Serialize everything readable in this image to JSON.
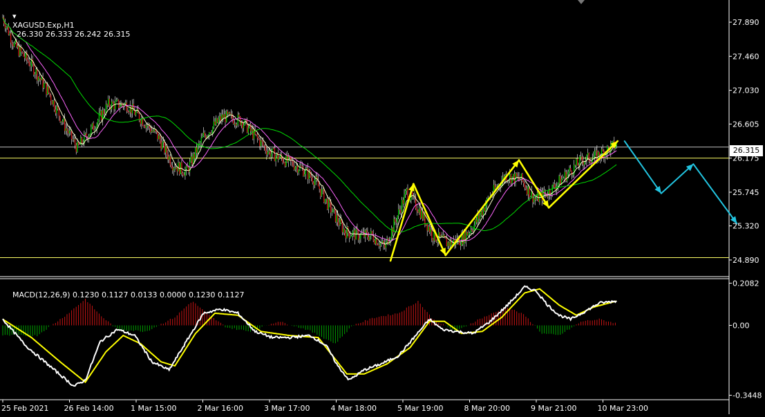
{
  "window": {
    "symbol": "XAGUSD.Exp,H1",
    "ohlc": "26.330 26.333 26.242 26.315"
  },
  "macd": {
    "label": "MACD(12,26,9) 0.1230 0.1127 0.0133 0.0000 0.1230 0.1127"
  },
  "current_price": "26.315",
  "colors": {
    "background": "#000000",
    "bull_candle": "#00c800",
    "bear_candle": "#c81414",
    "wick": "#ffffff",
    "ma_fast": "#ffffcc",
    "ma_mid": "#ff66ff",
    "ma_slow": "#00dd00",
    "horizontal_line": "#ffff66",
    "current_price_line": "#c0c0c0",
    "wave_arrow": "#ffff00",
    "projection_arrow": "#22c4e0",
    "macd_main": "#ffffff",
    "macd_signal": "#ffff00",
    "hist_positive": "#c81414",
    "hist_negative": "#00a000",
    "axis_text": "#ffffff"
  },
  "chart_data": [
    {
      "type": "candlestick",
      "title": "XAGUSD.Exp,H1",
      "y_ticks": [
        "27.890",
        "27.460",
        "27.030",
        "26.605",
        "26.175",
        "25.745",
        "25.320",
        "24.890"
      ],
      "ylim": [
        24.75,
        28.1
      ],
      "x_ticks": [
        "25 Feb 2021",
        "26 Feb 14:00",
        "1 Mar 15:00",
        "2 Mar 16:00",
        "3 Mar 17:00",
        "4 Mar 18:00",
        "5 Mar 19:00",
        "8 Mar 20:00",
        "9 Mar 21:00",
        "10 Mar 23:00"
      ],
      "close_path": [
        [
          0,
          27.95
        ],
        [
          10,
          27.6
        ],
        [
          25,
          27.35
        ],
        [
          40,
          27.0
        ],
        [
          55,
          26.55
        ],
        [
          65,
          26.3
        ],
        [
          78,
          26.55
        ],
        [
          92,
          26.85
        ],
        [
          108,
          26.85
        ],
        [
          122,
          26.65
        ],
        [
          135,
          26.45
        ],
        [
          148,
          26.1
        ],
        [
          160,
          26.0
        ],
        [
          175,
          26.45
        ],
        [
          192,
          26.7
        ],
        [
          208,
          26.65
        ],
        [
          220,
          26.45
        ],
        [
          232,
          26.25
        ],
        [
          246,
          26.15
        ],
        [
          260,
          26.05
        ],
        [
          272,
          25.9
        ],
        [
          285,
          25.55
        ],
        [
          298,
          25.25
        ],
        [
          310,
          25.2
        ],
        [
          322,
          25.2
        ],
        [
          333,
          25.05
        ],
        [
          340,
          25.3
        ],
        [
          352,
          25.75
        ],
        [
          362,
          25.55
        ],
        [
          375,
          25.2
        ],
        [
          388,
          25.1
        ],
        [
          400,
          25.15
        ],
        [
          412,
          25.35
        ],
        [
          425,
          25.7
        ],
        [
          438,
          25.95
        ],
        [
          452,
          25.9
        ],
        [
          464,
          25.65
        ],
        [
          476,
          25.75
        ],
        [
          490,
          25.95
        ],
        [
          505,
          26.15
        ],
        [
          518,
          26.2
        ],
        [
          535,
          26.35
        ]
      ],
      "horizontal_levels": [
        26.175,
        24.92
      ],
      "current_price": 26.315,
      "wave_path": [
        [
          338,
          24.88
        ],
        [
          358,
          25.85
        ],
        [
          386,
          24.95
        ],
        [
          450,
          26.15
        ],
        [
          476,
          25.55
        ],
        [
          536,
          26.39
        ]
      ],
      "projection_path": [
        [
          542,
          26.39
        ],
        [
          574,
          25.73
        ],
        [
          602,
          26.1
        ],
        [
          640,
          25.35
        ]
      ]
    },
    {
      "type": "line",
      "title": "MACD(12,26,9)",
      "y_ticks": [
        "0.2082",
        "0.00",
        "-0.3448"
      ],
      "ylim": [
        -0.36,
        0.22
      ],
      "series": [
        {
          "name": "MACD",
          "points": [
            [
              0,
              0.03
            ],
            [
              20,
              -0.1
            ],
            [
              45,
              -0.22
            ],
            [
              62,
              -0.3
            ],
            [
              72,
              -0.27
            ],
            [
              85,
              -0.08
            ],
            [
              100,
              -0.02
            ],
            [
              115,
              -0.05
            ],
            [
              130,
              -0.18
            ],
            [
              145,
              -0.22
            ],
            [
              160,
              -0.08
            ],
            [
              175,
              0.06
            ],
            [
              190,
              0.08
            ],
            [
              205,
              0.06
            ],
            [
              220,
              -0.03
            ],
            [
              235,
              -0.06
            ],
            [
              250,
              -0.06
            ],
            [
              268,
              -0.05
            ],
            [
              282,
              -0.1
            ],
            [
              292,
              -0.2
            ],
            [
              302,
              -0.27
            ],
            [
              315,
              -0.22
            ],
            [
              330,
              -0.19
            ],
            [
              345,
              -0.15
            ],
            [
              360,
              -0.05
            ],
            [
              372,
              0.03
            ],
            [
              383,
              -0.02
            ],
            [
              395,
              -0.03
            ],
            [
              410,
              -0.04
            ],
            [
              425,
              0.02
            ],
            [
              440,
              0.1
            ],
            [
              455,
              0.19
            ],
            [
              465,
              0.17
            ],
            [
              475,
              0.1
            ],
            [
              485,
              0.05
            ],
            [
              495,
              0.03
            ],
            [
              508,
              0.07
            ],
            [
              520,
              0.11
            ],
            [
              535,
              0.12
            ]
          ]
        },
        {
          "name": "Signal",
          "points": [
            [
              0,
              0.03
            ],
            [
              25,
              -0.06
            ],
            [
              50,
              -0.18
            ],
            [
              72,
              -0.28
            ],
            [
              90,
              -0.13
            ],
            [
              105,
              -0.05
            ],
            [
              120,
              -0.09
            ],
            [
              138,
              -0.18
            ],
            [
              150,
              -0.2
            ],
            [
              168,
              -0.04
            ],
            [
              185,
              0.06
            ],
            [
              205,
              0.05
            ],
            [
              225,
              -0.03
            ],
            [
              250,
              -0.05
            ],
            [
              275,
              -0.06
            ],
            [
              300,
              -0.24
            ],
            [
              315,
              -0.24
            ],
            [
              335,
              -0.19
            ],
            [
              355,
              -0.11
            ],
            [
              372,
              0.02
            ],
            [
              385,
              0.02
            ],
            [
              400,
              -0.04
            ],
            [
              418,
              -0.03
            ],
            [
              435,
              0.04
            ],
            [
              455,
              0.16
            ],
            [
              468,
              0.18
            ],
            [
              485,
              0.1
            ],
            [
              500,
              0.05
            ],
            [
              515,
              0.09
            ],
            [
              535,
              0.12
            ]
          ]
        },
        {
          "name": "Histogram",
          "type": "bar",
          "envelope": [
            [
              0,
              -0.05
            ],
            [
              30,
              -0.05
            ],
            [
              55,
              0.05
            ],
            [
              72,
              0.13
            ],
            [
              85,
              0.05
            ],
            [
              100,
              -0.02
            ],
            [
              125,
              -0.03
            ],
            [
              150,
              0.04
            ],
            [
              165,
              0.12
            ],
            [
              180,
              0.05
            ],
            [
              195,
              -0.01
            ],
            [
              215,
              -0.03
            ],
            [
              240,
              0.02
            ],
            [
              265,
              -0.02
            ],
            [
              290,
              -0.09
            ],
            [
              305,
              0.0
            ],
            [
              325,
              0.04
            ],
            [
              345,
              0.06
            ],
            [
              362,
              0.12
            ],
            [
              375,
              0.03
            ],
            [
              395,
              -0.03
            ],
            [
              415,
              0.03
            ],
            [
              440,
              0.09
            ],
            [
              455,
              0.05
            ],
            [
              470,
              -0.04
            ],
            [
              485,
              -0.05
            ],
            [
              505,
              0.02
            ],
            [
              520,
              0.03
            ],
            [
              535,
              0.01
            ]
          ]
        }
      ]
    }
  ]
}
